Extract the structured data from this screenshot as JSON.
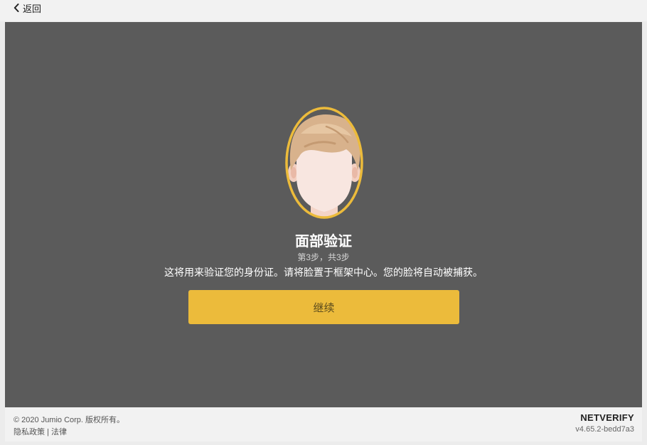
{
  "header": {
    "back_label": "返回"
  },
  "main": {
    "title": "面部验证",
    "step": "第3步，共3步",
    "description": "这将用来验证您的身份证。请将脸置于框架中心。您的脸将自动被捕获。",
    "continue_label": "继续"
  },
  "footer": {
    "copyright": "© 2020 Jumio Corp. 版权所有。",
    "privacy_link": "隐私政策",
    "separator": "|",
    "legal_link": "法律",
    "brand": "NETVERIFY",
    "version": "v4.65.2-bedd7a3"
  },
  "colors": {
    "main_background": "#5b5b5b",
    "accent": "#ecbb3b",
    "header_background": "#f2f2f2"
  }
}
